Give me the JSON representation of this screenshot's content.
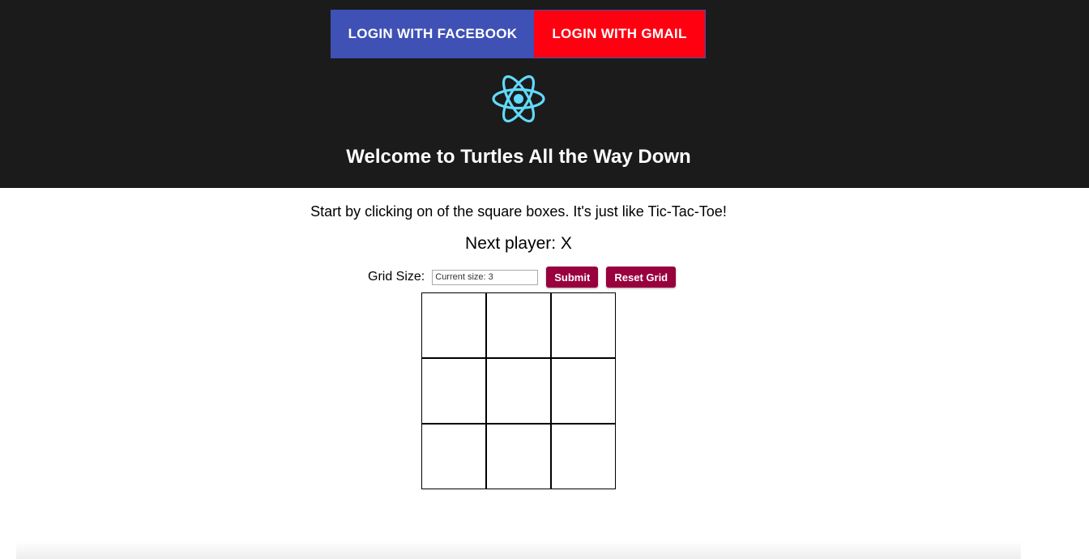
{
  "header": {
    "login_facebook_label": "LOGIN WITH FACEBOOK",
    "login_gmail_label": "LOGIN WITH GMAIL",
    "logo_icon": "react-atom-icon",
    "title": "Welcome to Turtles All the Way Down",
    "colors": {
      "background": "#1b1b1b",
      "facebook": "#3f51b5",
      "gmail": "#ff0010",
      "logo": "#61dafb"
    }
  },
  "game": {
    "intro": "Start by clicking on of the square boxes. It's just like Tic-Tac-Toe!",
    "next_player_text": "Next player: X",
    "grid_size_label": "Grid Size:",
    "grid_size_placeholder": "Current size: 3",
    "submit_label": "Submit",
    "reset_label": "Reset Grid",
    "button_color": "#98003e",
    "board": {
      "size": 3,
      "squares": [
        "",
        "",
        "",
        "",
        "",
        "",
        "",
        "",
        ""
      ]
    }
  }
}
